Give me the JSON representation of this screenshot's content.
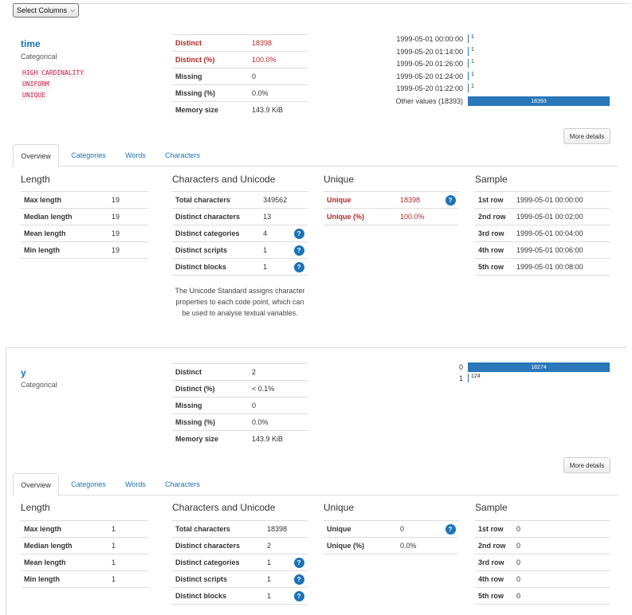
{
  "toolbar": {
    "select_label": "Select Columns"
  },
  "variables": [
    {
      "name": "time",
      "type": "Categorical",
      "alerts": [
        "HIGH CARDINALITY",
        "UNIFORM",
        "UNIQUE"
      ],
      "stats": [
        {
          "k": "Distinct",
          "v": "18398",
          "warn": true
        },
        {
          "k": "Distinct (%)",
          "v": "100.0%",
          "warn": true
        },
        {
          "k": "Missing",
          "v": "0"
        },
        {
          "k": "Missing (%)",
          "v": "0.0%"
        },
        {
          "k": "Memory size",
          "v": "143.9 KiB"
        }
      ],
      "freq": [
        {
          "label": "1999-05-01 00:00:00",
          "count": "1"
        },
        {
          "label": "1999-05-20 01:14:00",
          "count": "1"
        },
        {
          "label": "1999-05-20 01:26:00",
          "count": "1"
        },
        {
          "label": "1999-05-20 01:24:00",
          "count": "1"
        },
        {
          "label": "1999-05-20 01:22:00",
          "count": "1"
        },
        {
          "label": "Other values (18393)",
          "count": "18393",
          "bar": true
        }
      ],
      "more_details": "More details",
      "tabs": [
        "Overview",
        "Categories",
        "Words",
        "Characters"
      ],
      "length": {
        "title": "Length",
        "rows": [
          {
            "k": "Max length",
            "v": "19"
          },
          {
            "k": "Median length",
            "v": "19"
          },
          {
            "k": "Mean length",
            "v": "19"
          },
          {
            "k": "Min length",
            "v": "19"
          }
        ]
      },
      "unicode": {
        "title": "Characters and Unicode",
        "rows": [
          {
            "k": "Total characters",
            "v": "349562"
          },
          {
            "k": "Distinct characters",
            "v": "13"
          },
          {
            "k": "Distinct categories",
            "v": "4",
            "help": "?"
          },
          {
            "k": "Distinct scripts",
            "v": "1",
            "help": "?"
          },
          {
            "k": "Distinct blocks",
            "v": "1",
            "help": "?"
          }
        ],
        "note": "The Unicode Standard assigns character properties to each code point, which can be used to analyse textual variables."
      },
      "unique": {
        "title": "Unique",
        "rows": [
          {
            "k": "Unique",
            "v": "18398",
            "help": "?",
            "warn": true
          },
          {
            "k": "Unique (%)",
            "v": "100.0%",
            "warn": true
          }
        ]
      },
      "sample": {
        "title": "Sample",
        "rows": [
          {
            "k": "1st row",
            "v": "1999-05-01 00:00:00"
          },
          {
            "k": "2nd row",
            "v": "1999-05-01 00:02:00"
          },
          {
            "k": "3rd row",
            "v": "1999-05-01 00:04:00"
          },
          {
            "k": "4th row",
            "v": "1999-05-01 00:06:00"
          },
          {
            "k": "5th row",
            "v": "1999-05-01 00:08:00"
          }
        ]
      }
    },
    {
      "name": "y",
      "type": "Categorical",
      "alerts": [],
      "stats": [
        {
          "k": "Distinct",
          "v": "2"
        },
        {
          "k": "Distinct (%)",
          "v": "< 0.1%"
        },
        {
          "k": "Missing",
          "v": "0"
        },
        {
          "k": "Missing (%)",
          "v": "0.0%"
        },
        {
          "k": "Memory size",
          "v": "143.9 KiB"
        }
      ],
      "freq": [
        {
          "label": "0",
          "count": "18274",
          "bar": true
        },
        {
          "label": "1",
          "count": "124"
        }
      ],
      "more_details": "More details",
      "tabs": [
        "Overview",
        "Categories",
        "Words",
        "Characters"
      ],
      "length": {
        "title": "Length",
        "rows": [
          {
            "k": "Max length",
            "v": "1"
          },
          {
            "k": "Median length",
            "v": "1"
          },
          {
            "k": "Mean length",
            "v": "1"
          },
          {
            "k": "Min length",
            "v": "1"
          }
        ]
      },
      "unicode": {
        "title": "Characters and Unicode",
        "rows": [
          {
            "k": "Total characters",
            "v": "18398"
          },
          {
            "k": "Distinct characters",
            "v": "2"
          },
          {
            "k": "Distinct categories",
            "v": "1",
            "help": "?"
          },
          {
            "k": "Distinct scripts",
            "v": "1",
            "help": "?"
          },
          {
            "k": "Distinct blocks",
            "v": "1",
            "help": "?"
          }
        ]
      },
      "unique": {
        "title": "Unique",
        "rows": [
          {
            "k": "Unique",
            "v": "0",
            "help": "?"
          },
          {
            "k": "Unique (%)",
            "v": "0.0%"
          }
        ]
      },
      "sample": {
        "title": "Sample",
        "rows": [
          {
            "k": "1st row",
            "v": "0"
          },
          {
            "k": "2nd row",
            "v": "0"
          },
          {
            "k": "3rd row",
            "v": "0"
          },
          {
            "k": "4th row",
            "v": "0"
          },
          {
            "k": "5th row",
            "v": "0"
          }
        ]
      }
    }
  ]
}
